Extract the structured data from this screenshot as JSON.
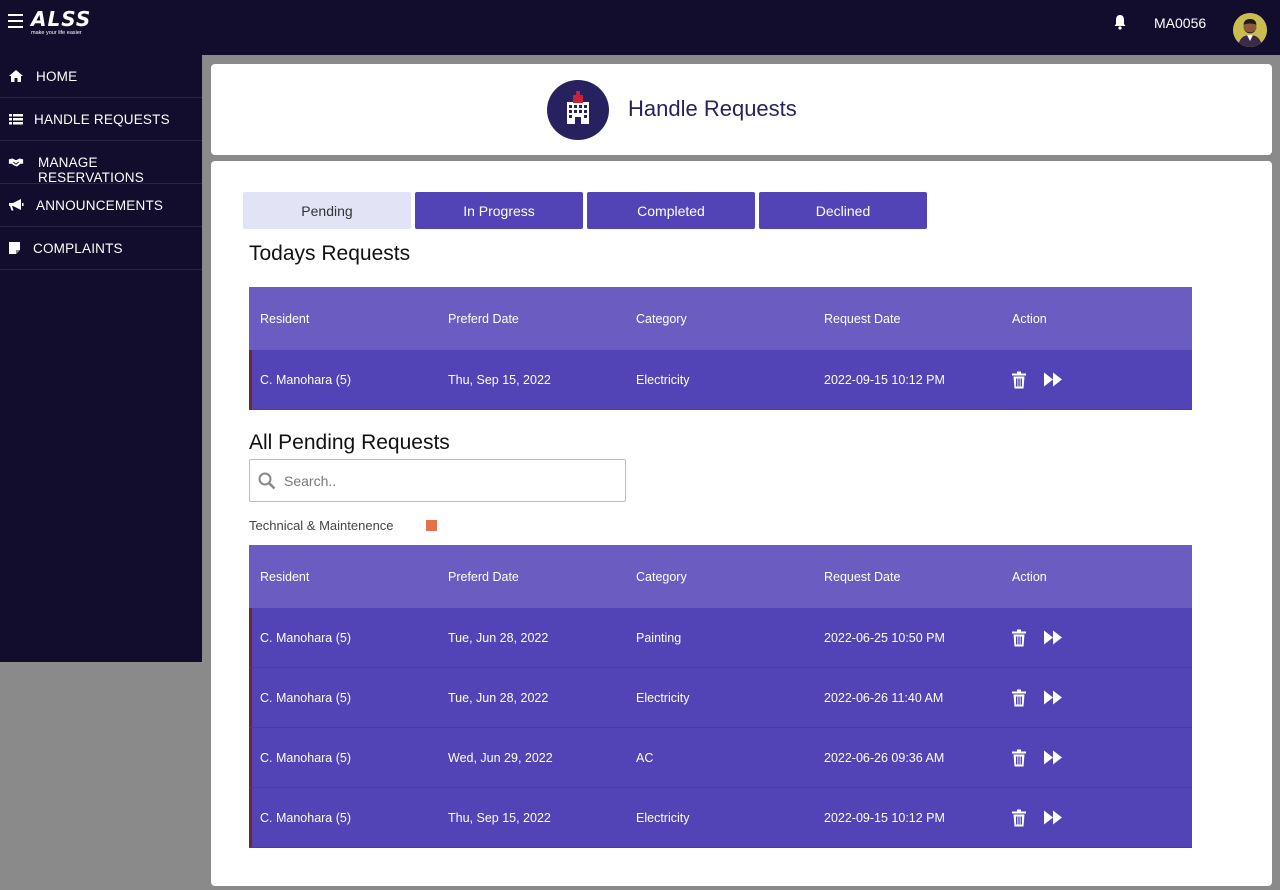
{
  "app": {
    "logo_text": "ALSS",
    "logo_tagline": "make your life easier",
    "user_id": "MA0056"
  },
  "sidebar": {
    "items": [
      {
        "label": "HOME",
        "icon": "home-icon"
      },
      {
        "label": "HANDLE REQUESTS",
        "icon": "list-icon"
      },
      {
        "label": "MANAGE RESERVATIONS",
        "icon": "handshake-icon"
      },
      {
        "label": "ANNOUNCEMENTS",
        "icon": "megaphone-icon"
      },
      {
        "label": "COMPLAINTS",
        "icon": "note-icon"
      }
    ]
  },
  "header": {
    "title": "Handle Requests",
    "icon": "building-icon"
  },
  "tabs": [
    {
      "label": "Pending",
      "active": true
    },
    {
      "label": "In Progress",
      "active": false
    },
    {
      "label": "Completed",
      "active": false
    },
    {
      "label": "Declined",
      "active": false
    }
  ],
  "today": {
    "title": "Todays Requests",
    "columns": [
      "Resident",
      "Preferd Date",
      "Category",
      "Request Date",
      "Action"
    ],
    "rows": [
      {
        "resident": "C. Manohara (5)",
        "preferred": "Thu, Sep 15, 2022",
        "category": "Electricity",
        "requested": "2022-09-15 10:12 PM"
      }
    ]
  },
  "pending": {
    "title": "All Pending Requests",
    "search_placeholder": "Search..",
    "legend_label": "Technical & Maintenence",
    "legend_color": "#e6704e",
    "columns": [
      "Resident",
      "Preferd Date",
      "Category",
      "Request Date",
      "Action"
    ],
    "rows": [
      {
        "resident": "C. Manohara (5)",
        "preferred": "Tue, Jun 28, 2022",
        "category": "Painting",
        "requested": "2022-06-25 10:50 PM"
      },
      {
        "resident": "C. Manohara (5)",
        "preferred": "Tue, Jun 28, 2022",
        "category": "Electricity",
        "requested": "2022-06-26 11:40 AM"
      },
      {
        "resident": "C. Manohara (5)",
        "preferred": "Wed, Jun 29, 2022",
        "category": "AC",
        "requested": "2022-06-26 09:36 AM"
      },
      {
        "resident": "C. Manohara (5)",
        "preferred": "Thu, Sep 15, 2022",
        "category": "Electricity",
        "requested": "2022-09-15 10:12 PM"
      }
    ]
  },
  "colors": {
    "nav_bg": "#120d2c",
    "primary": "#5243b6",
    "header_row": "#6b5cc2",
    "title": "#27225f"
  }
}
